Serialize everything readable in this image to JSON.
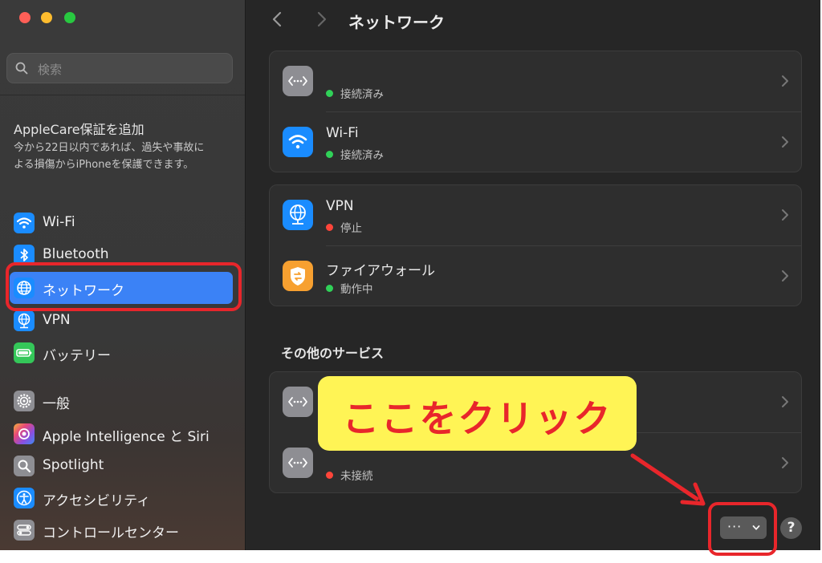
{
  "sidebar": {
    "search_placeholder": "検索",
    "promo_title": "AppleCare保証を追加",
    "promo_body": "今から22日以内であれば、過失や事故による損傷からiPhoneを保護できます。",
    "items": [
      {
        "label": "Wi-Fi",
        "icon": "wifi-icon",
        "color": "#1a8cff"
      },
      {
        "label": "Bluetooth",
        "icon": "bluetooth-icon",
        "color": "#1a8cff"
      },
      {
        "label": "ネットワーク",
        "icon": "globe-icon",
        "color": "#1a8cff"
      },
      {
        "label": "VPN",
        "icon": "vpn-globe-icon",
        "color": "#1a8cff"
      },
      {
        "label": "バッテリー",
        "icon": "battery-icon",
        "color": "#34c759"
      },
      {
        "label": "一般",
        "icon": "gear-icon",
        "color": "#8e8e93"
      },
      {
        "label": "Apple Intelligence と Siri",
        "icon": "siri-icon",
        "color": "#b455d8"
      },
      {
        "label": "Spotlight",
        "icon": "magnifier-icon",
        "color": "#8e8e93"
      },
      {
        "label": "アクセシビリティ",
        "icon": "accessibility-icon",
        "color": "#1a8cff"
      },
      {
        "label": "コントロールセンター",
        "icon": "control-center-icon",
        "color": "#8e8e93"
      }
    ]
  },
  "main": {
    "title": "ネットワーク",
    "group1": [
      {
        "name": "",
        "status": "接続済み",
        "status_color": "#30d158",
        "icon": "ethernet-icon"
      },
      {
        "name": "Wi-Fi",
        "status": "接続済み",
        "status_color": "#30d158",
        "icon": "wifi-icon"
      }
    ],
    "group2": [
      {
        "name": "VPN",
        "status": "停止",
        "status_color": "#ff453a",
        "icon": "vpn-globe-icon"
      },
      {
        "name": "ファイアウォール",
        "status": "動作中",
        "status_color": "#30d158",
        "icon": "firewall-icon"
      }
    ],
    "other_section_title": "その他のサービス",
    "group3": [
      {
        "name": "",
        "status": "",
        "status_color": "#30d158",
        "icon": "ethernet-icon"
      },
      {
        "name": "",
        "status": "未接続",
        "status_color": "#ff453a",
        "icon": "ethernet-icon"
      }
    ],
    "more_button": "···",
    "help_button": "?"
  },
  "annotation": {
    "callout_text": "ここをクリック",
    "accent": "#e8262b",
    "callout_bg": "#fff455"
  }
}
